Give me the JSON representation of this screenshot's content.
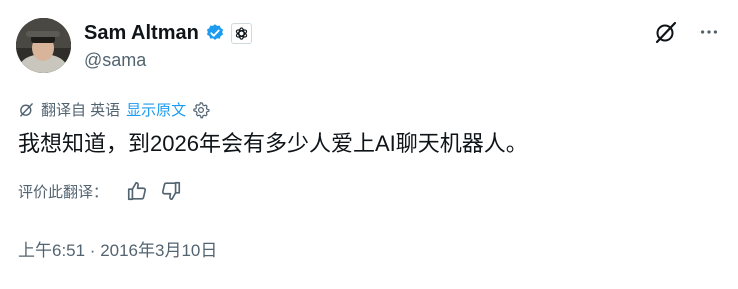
{
  "author": {
    "name": "Sam Altman",
    "handle": "@sama"
  },
  "translation_bar": {
    "translated_from": "翻译自 英语",
    "show_original": "显示原文"
  },
  "tweet": {
    "text": "我想知道，到2026年会有多少人爱上AI聊天机器人。"
  },
  "rating": {
    "label": "评价此翻译："
  },
  "timestamp": "上午6:51 · 2016年3月10日",
  "colors": {
    "accent": "#1d9bf0",
    "muted": "#536471",
    "text": "#0f1419"
  },
  "icons": {
    "verified": "verified-badge-icon",
    "affiliation": "openai-logo-icon",
    "grok": "grok-icon",
    "more": "more-dots-icon",
    "translate": "translate-icon",
    "settings": "gear-icon",
    "like": "thumbs-up-icon",
    "dislike": "thumbs-down-icon"
  }
}
